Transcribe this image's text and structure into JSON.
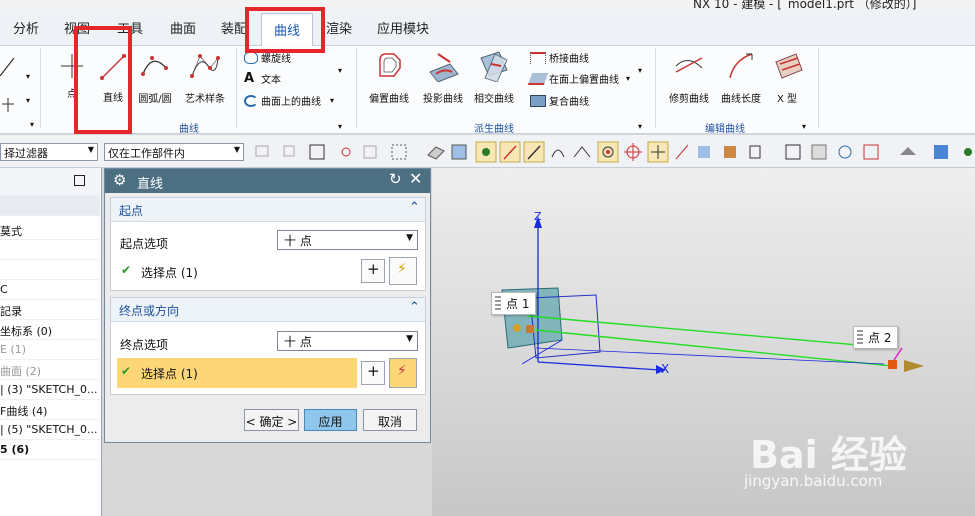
{
  "window": {
    "title": "NX 10 - 建模 - [_model1.prt （修改的）]"
  },
  "menu": {
    "tabs": [
      "分析",
      "视图",
      "工具",
      "曲面",
      "装配",
      "曲线",
      "渲染",
      "应用模块"
    ],
    "active": "曲线"
  },
  "ribbon": {
    "point_label": "点",
    "line_label": "直线",
    "arc_label": "圆弧/圆",
    "spline_label": "艺术样条",
    "helix_label": "螺旋线",
    "text_label": "文本",
    "curve_on_surface_label": "曲面上的曲线",
    "group_curve": "曲线",
    "offset_curve_label": "偏置曲线",
    "project_curve_label": "投影曲线",
    "intersect_curve_label": "相交曲线",
    "bridge_curve_label": "桥接曲线",
    "offset_on_face_label": "在面上偏置曲线",
    "composite_curve_label": "复合曲线",
    "group_derived": "派生曲线",
    "trim_curve_label": "修剪曲线",
    "curve_length_label": "曲线长度",
    "x_type_label": "X 型",
    "group_edit": "编辑曲线"
  },
  "toolbar": {
    "filter_value": "择过滤器",
    "scope_value": "仅在工作部件内"
  },
  "navigator": {
    "rows": [
      "",
      "莫式",
      "",
      "",
      "C",
      "記录",
      "坐标系 (0)",
      "E (1)",
      "曲面 (2)",
      "| (3) \"SKETCH_0...",
      "F曲线 (4)",
      "| (5) \"SKETCH_0...",
      "5 (6)"
    ]
  },
  "dialog": {
    "title": "直线",
    "start": {
      "header": "起点",
      "option_label": "起点选项",
      "option_value": "十 点",
      "select_label": "选择点 (1)"
    },
    "end": {
      "header": "终点或方向",
      "option_label": "终点选项",
      "option_value": "十 点",
      "select_label": "选择点 (1)"
    },
    "ok_label": "< 确定 >",
    "apply_label": "应用",
    "cancel_label": "取消"
  },
  "viewport": {
    "point1_label": "点 1",
    "point2_label": "点 2",
    "axis_z": "Z",
    "axis_x": "X",
    "watermark_main": "Bai 经验",
    "watermark_sub": "jingyan.baidu.com"
  },
  "colors": {
    "accent": "#1a56b8",
    "highlight": "#e5262b",
    "dialog_header": "#4d6f82",
    "line_green": "#22dd22",
    "selected_row": "#fdd777"
  }
}
